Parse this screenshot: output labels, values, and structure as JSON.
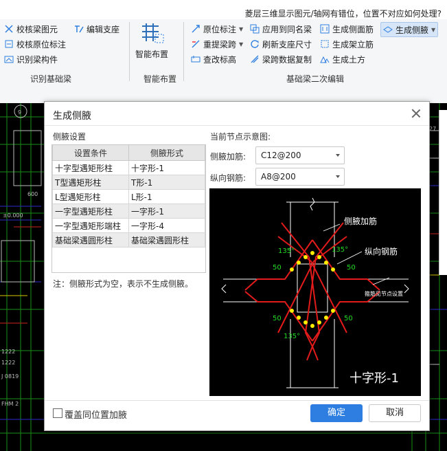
{
  "notice": "菱层三维显示图元/轴网有错位，位置不对应如何处理?",
  "ribbon": {
    "check_beam": "校核梁图元",
    "edit_support": "编辑支座",
    "check_original": "校核原位标注",
    "identify_beam": "识别梁构件",
    "identify_group": "识别基础梁",
    "smart_layout": "智能布置",
    "smart_group": "智能布置",
    "original_label": "原位标注",
    "reprop_span": "重提梁跨",
    "modify_elev": "查改标高",
    "apply_same": "应用到同名梁",
    "refresh_support": "刷新支座尺寸",
    "span_copy": "梁跨数据复制",
    "gen_side": "生成侧面筋",
    "gen_stirrup": "生成架立筋",
    "gen_earth": "生成土方",
    "gen_haunch": "生成侧腋",
    "second_edit_group": "基础梁二次编辑"
  },
  "dialog": {
    "title": "生成侧腋",
    "settings_label": "侧腋设置",
    "table": {
      "headers": [
        "设置条件",
        "侧腋形式"
      ],
      "rows": [
        [
          "十字型遇矩形柱",
          "十字形-1"
        ],
        [
          "T型遇矩形柱",
          "T形-1"
        ],
        [
          "L型遇矩形柱",
          "L形-1"
        ],
        [
          "一字型遇矩形柱",
          "一字形-1"
        ],
        [
          "一字型遇矩形端柱",
          "一字形-4"
        ],
        [
          "基础梁遇圆形柱",
          "基础梁遇圆形柱"
        ]
      ]
    },
    "note": "注：侧腋形式为空，表示不生成侧腋。",
    "preview_label": "当前节点示意图:",
    "haunch_rebar_label": "侧腋加筋:",
    "haunch_rebar_value": "C12@200",
    "long_rebar_label": "纵向钢筋:",
    "long_rebar_value": "A8@200",
    "preview": {
      "haunch_rebar": "侧腋加筋",
      "long_rebar": "纵向钢筋",
      "n135a": "135°",
      "n135b": "135°",
      "n135c": "135°",
      "n50a": "50",
      "n50b": "50",
      "n50c": "50",
      "n50d": "50",
      "node_note": "箍筋见节点设置",
      "shape_name": "十字形-1"
    },
    "cover_same": "覆盖同位置加腋",
    "ok": "确定",
    "cancel": "取消"
  },
  "colors": {
    "accent": "#2d7ee0",
    "red_rebar": "#e31b1b",
    "yellow_dot": "#ffee00",
    "green_text": "#22dd22"
  }
}
